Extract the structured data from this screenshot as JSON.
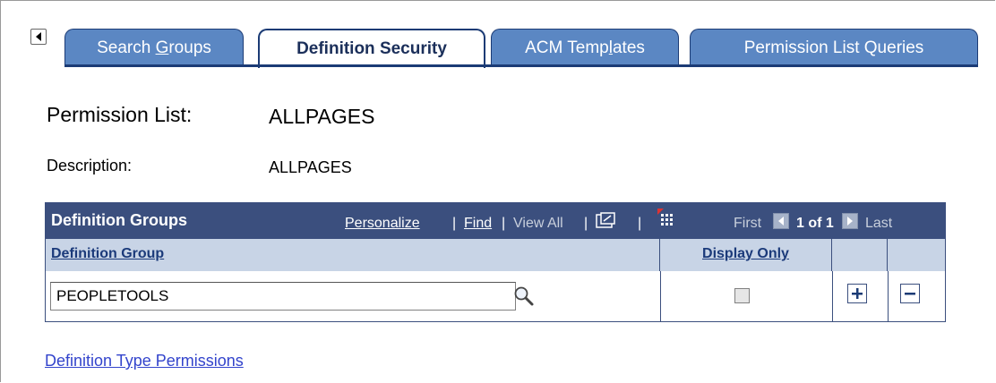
{
  "tabs": [
    {
      "label_pre": "Search ",
      "label_u": "G",
      "label_post": "roups",
      "active": false
    },
    {
      "label_pre": "Definition Security",
      "label_u": "",
      "label_post": "",
      "active": true
    },
    {
      "label_pre": "ACM Temp",
      "label_u": "l",
      "label_post": "ates",
      "active": false
    },
    {
      "label_pre": "Permission List Queries",
      "label_u": "",
      "label_post": "",
      "active": false
    }
  ],
  "fields": {
    "permission_list_label": "Permission List:",
    "permission_list_value": "ALLPAGES",
    "description_label": "Description:",
    "description_value": "ALLPAGES"
  },
  "grid": {
    "title": "Definition Groups",
    "personalize": "Personalize",
    "find": "Find",
    "view_all": "View All",
    "sep": "|",
    "first": "First",
    "range": "1 of 1",
    "last": "Last",
    "columns": {
      "definition_group": "Definition Group",
      "display_only": "Display Only"
    },
    "rows": [
      {
        "definition_group": "PEOPLETOOLS",
        "display_only": false
      }
    ]
  },
  "link": "Definition Type Permissions",
  "icons": [
    "tab-scroll-left-icon",
    "zoom-icon",
    "download-grid-icon",
    "nav-first-icon",
    "nav-last-icon",
    "lookup-icon",
    "add-row-icon",
    "delete-row-icon"
  ],
  "colors": {
    "tab": "#5b87c3",
    "tab_border": "#1b3b75",
    "grid_header": "#3b4f7e",
    "col_header": "#c8d4e6",
    "link": "#3344cc"
  }
}
